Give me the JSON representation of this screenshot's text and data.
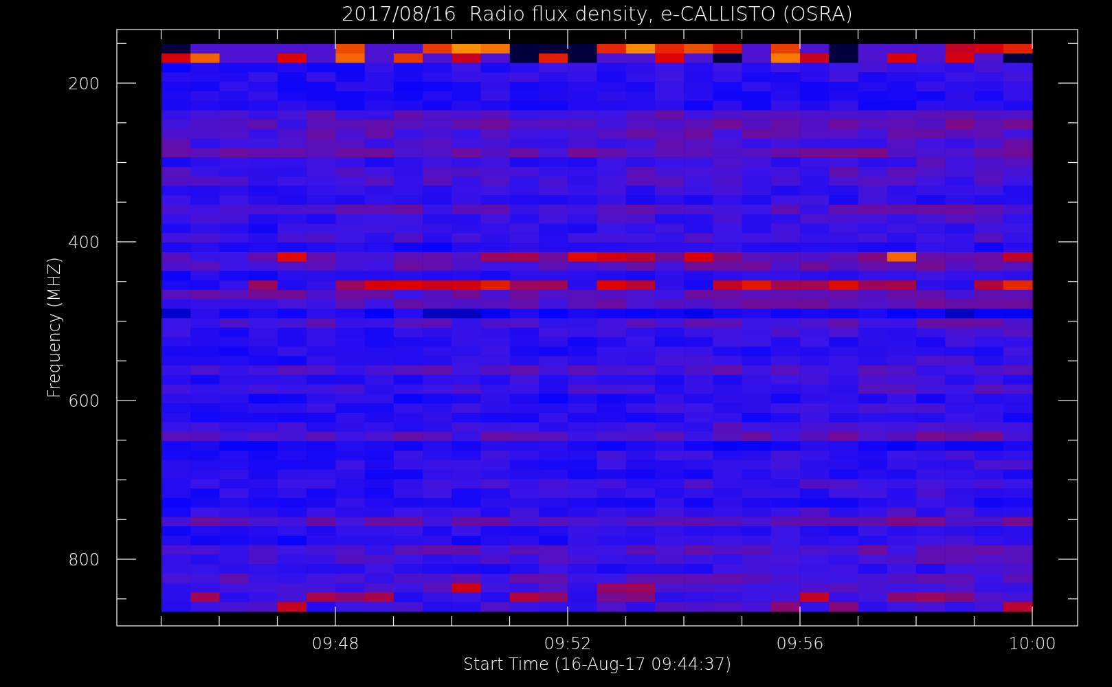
{
  "title": "2017/08/16  Radio flux density, e-CALLISTO (OSRA)",
  "y_axis": {
    "label": "Frequency (MHZ)",
    "ticks": [
      "200",
      "400",
      "600",
      "800"
    ]
  },
  "x_axis": {
    "label": "Start Time (16-Aug-17 09:44:37)",
    "ticks": [
      "09:48",
      "09:52",
      "09:56",
      "10:00"
    ]
  }
}
